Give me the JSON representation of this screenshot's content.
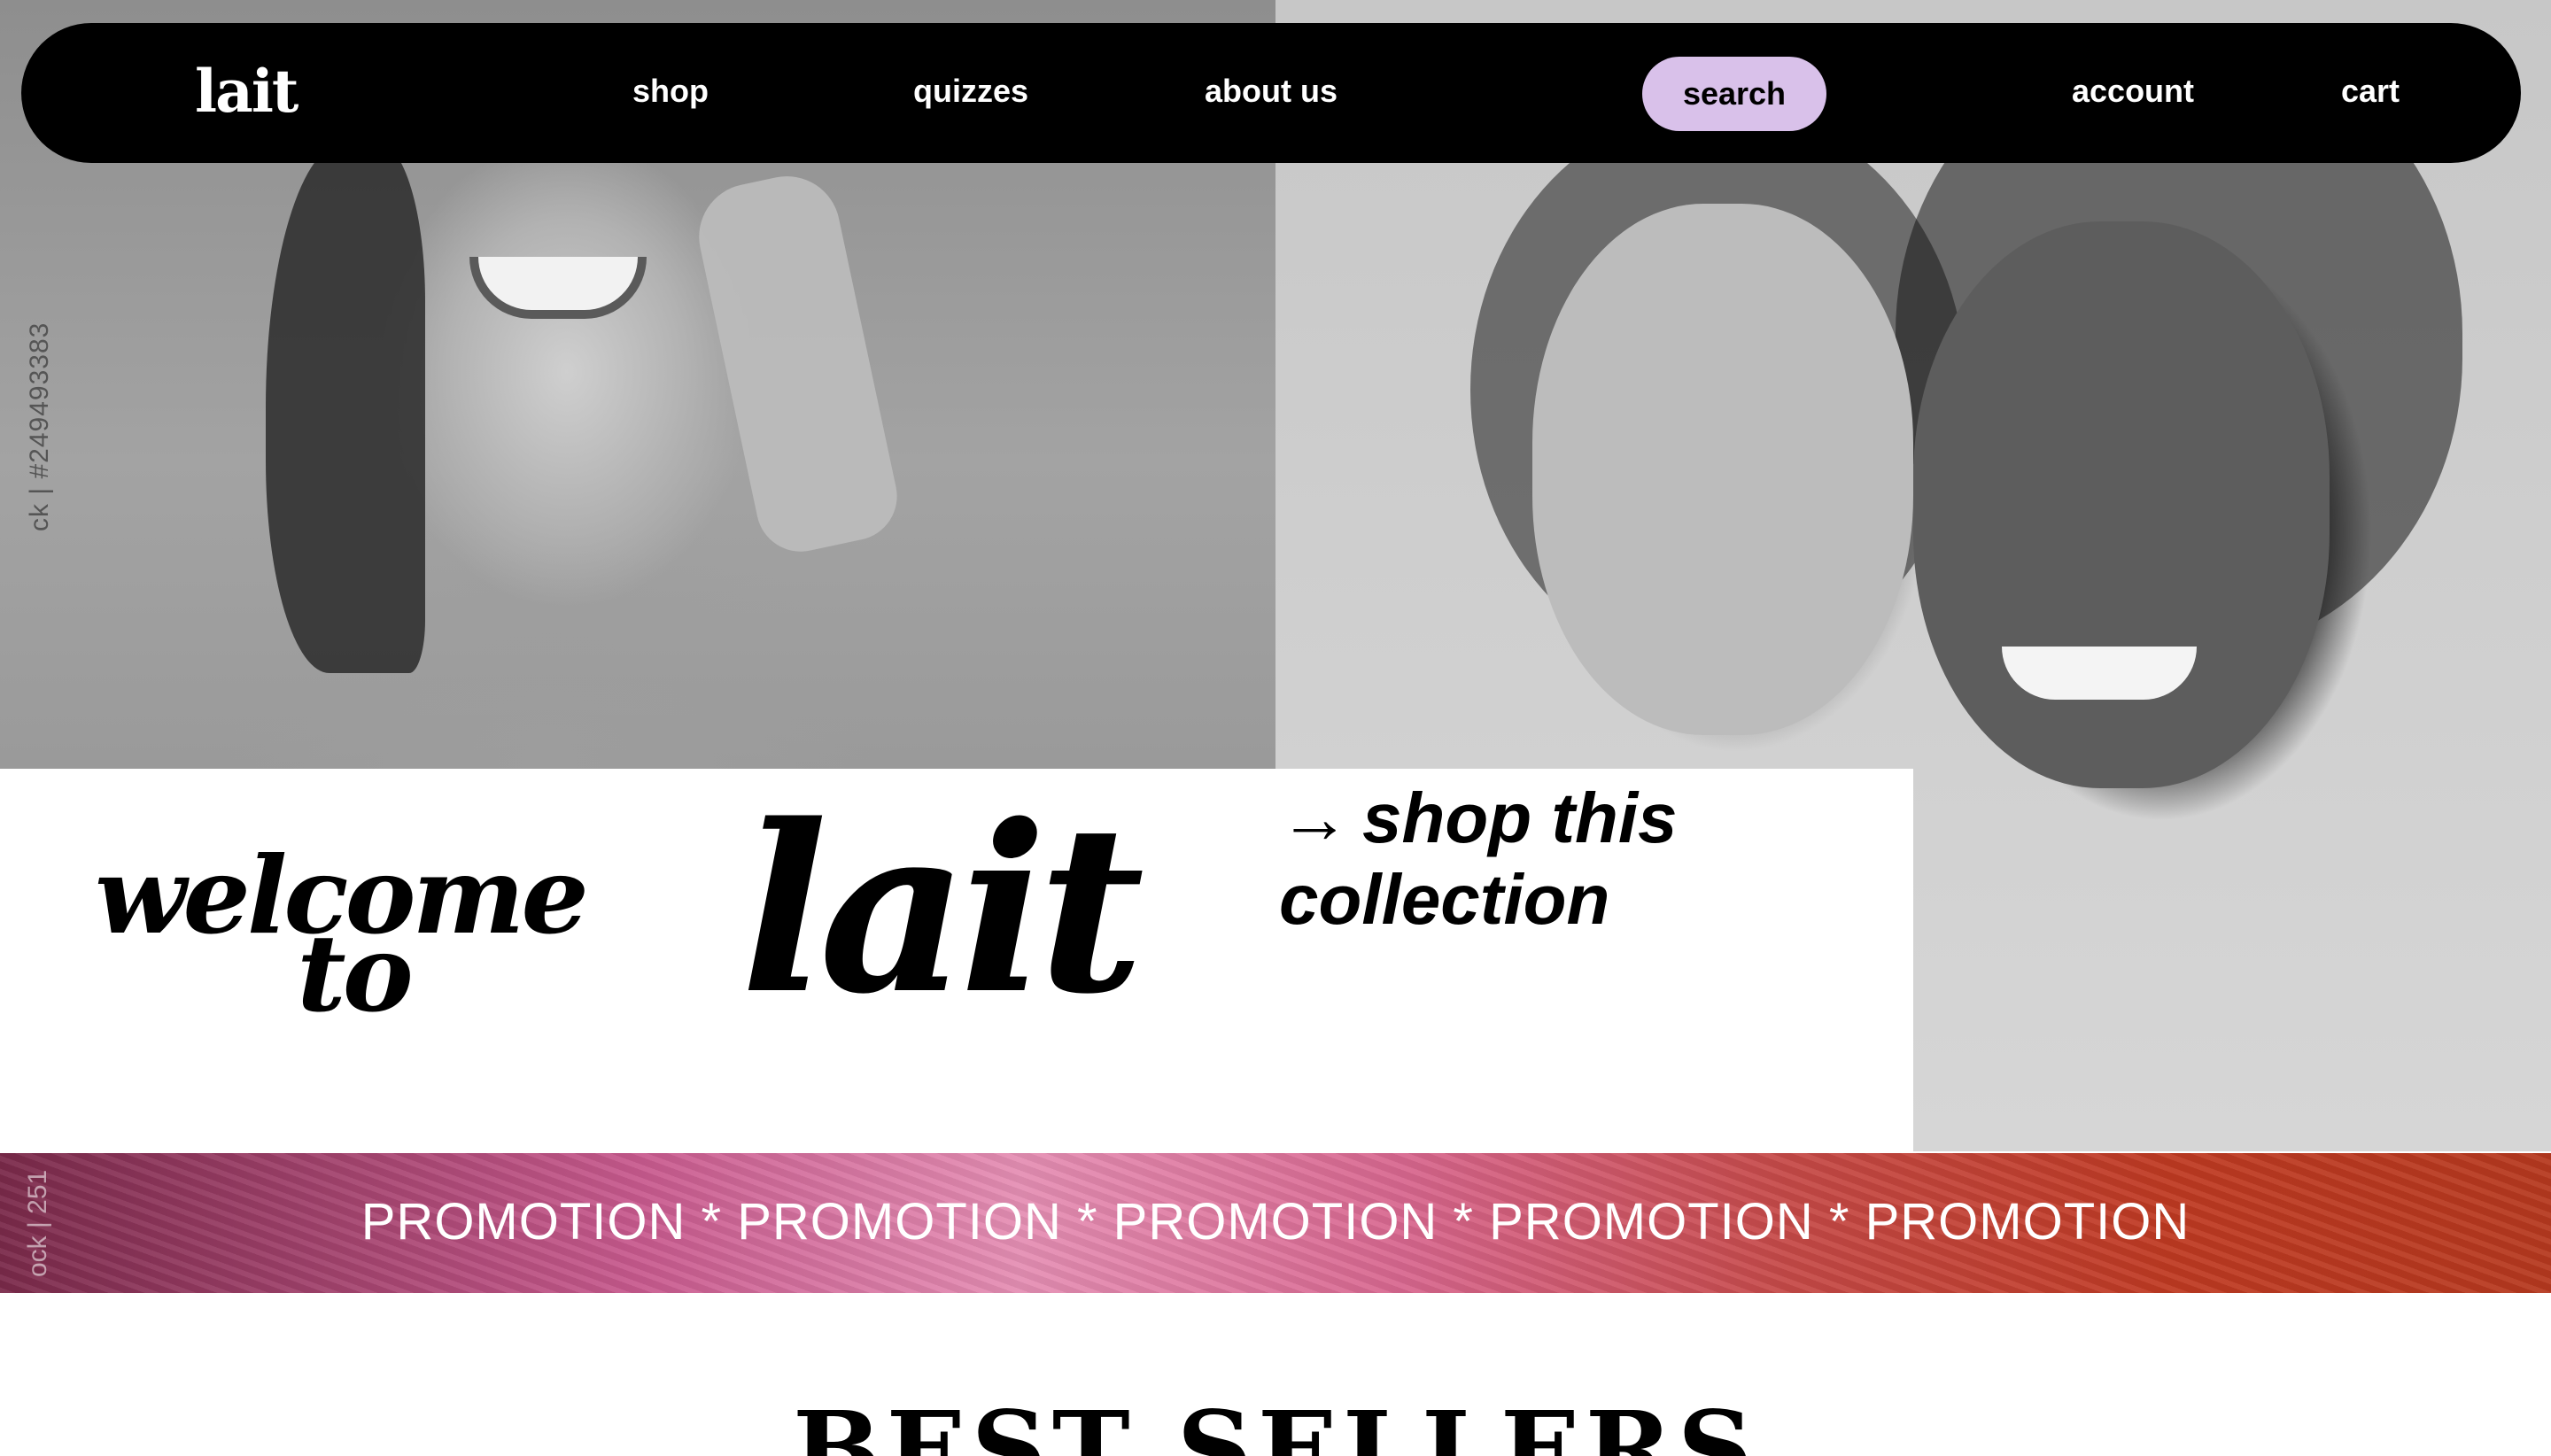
{
  "nav": {
    "logo": "lait",
    "items": {
      "shop": "shop",
      "quizzes": "quizzes",
      "about": "about us",
      "search": "search",
      "account": "account",
      "cart": "cart"
    },
    "search_highlight_color": "#d9c1ea"
  },
  "hero": {
    "side_watermark": "ck | #249493383"
  },
  "welcome": {
    "line1": "welcome",
    "line2": "to",
    "brand": "lait",
    "cta_arrow": "→",
    "cta": "shop this collection"
  },
  "promo": {
    "text": "PROMOTION * PROMOTION * PROMOTION * PROMOTION * PROMOTION",
    "side_watermark": "ock | 251"
  },
  "best_sellers": {
    "title": "BEST SELLERS"
  },
  "icons": [
    "arrow-right-icon"
  ]
}
